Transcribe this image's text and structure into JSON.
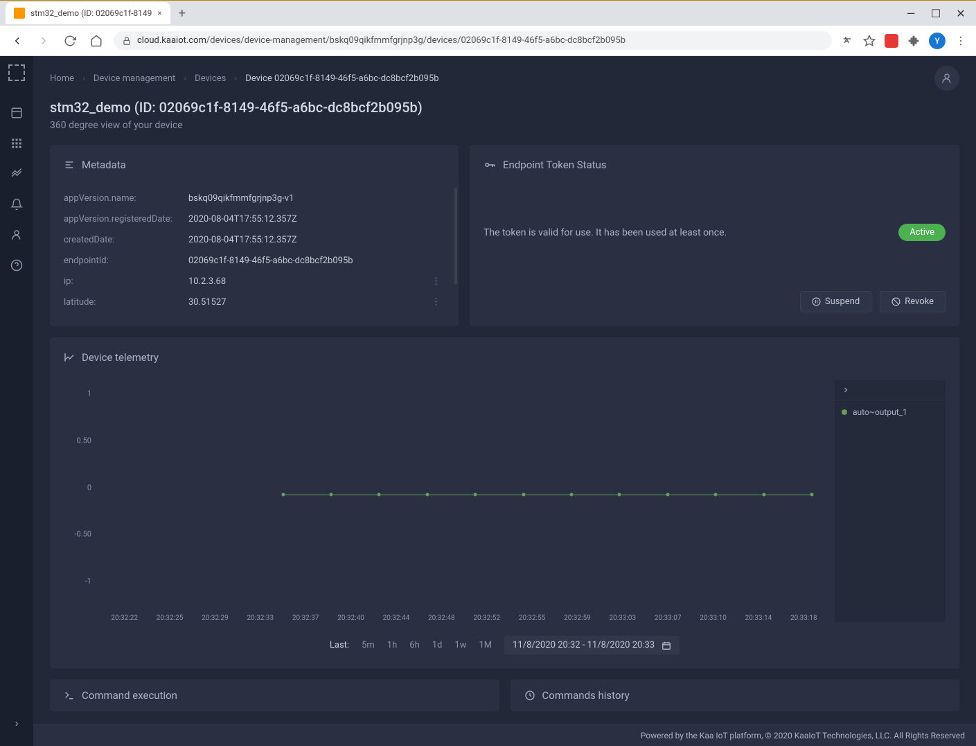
{
  "browser": {
    "tab_title": "stm32_demo (ID: 02069c1f-8149",
    "url_host": "cloud.kaaiot.com",
    "url_path": "/devices/device-management/bskq09qikfmmfgrjnp3g/devices/02069c1f-8149-46f5-a6bc-dc8bcf2b095b",
    "avatar_letter": "Y"
  },
  "breadcrumbs": {
    "items": [
      "Home",
      "Device management",
      "Devices"
    ],
    "current": "Device 02069c1f-8149-46f5-a6bc-dc8bcf2b095b"
  },
  "header": {
    "title": "stm32_demo (ID: 02069c1f-8149-46f5-a6bc-dc8bcf2b095b)",
    "subtitle": "360 degree view of your device"
  },
  "metadata": {
    "title": "Metadata",
    "rows": [
      {
        "key": "appVersion.name:",
        "val": "bskq09qikfmmfgrjnp3g-v1",
        "more": false
      },
      {
        "key": "appVersion.registeredDate:",
        "val": "2020-08-04T17:55:12.357Z",
        "more": false
      },
      {
        "key": "createdDate:",
        "val": "2020-08-04T17:55:12.357Z",
        "more": false
      },
      {
        "key": "endpointId:",
        "val": "02069c1f-8149-46f5-a6bc-dc8bcf2b095b",
        "more": false
      },
      {
        "key": "ip:",
        "val": "10.2.3.68",
        "more": true
      },
      {
        "key": "latitude:",
        "val": "30.51527",
        "more": true
      }
    ]
  },
  "token": {
    "title": "Endpoint Token Status",
    "message": "The token is valid for use. It has been used at least once.",
    "badge": "Active",
    "suspend": "Suspend",
    "revoke": "Revoke"
  },
  "telemetry": {
    "title": "Device telemetry",
    "legend": "auto~output_1",
    "time_label": "Last:",
    "ranges": [
      "5m",
      "1h",
      "6h",
      "1d",
      "1w",
      "1M"
    ],
    "time_range": "11/8/2020 20:32 - 11/8/2020 20:33"
  },
  "chart_data": {
    "type": "line",
    "title": "Device telemetry",
    "xlabel": "",
    "ylabel": "",
    "ylim": [
      -1,
      1
    ],
    "y_ticks": [
      "1",
      "0.50",
      "0",
      "-0.50",
      "-1"
    ],
    "x_ticks": [
      "20:32:22",
      "20:32:25",
      "20:32:29",
      "20:32:33",
      "20:32:37",
      "20:32:40",
      "20:32:44",
      "20:32:48",
      "20:32:52",
      "20:32:55",
      "20:32:59",
      "20:33:03",
      "20:33:07",
      "20:33:10",
      "20:33:14",
      "20:33:18"
    ],
    "series": [
      {
        "name": "auto~output_1",
        "color": "#6b9b5e",
        "x": [
          "20:32:37",
          "20:32:40",
          "20:32:44",
          "20:32:48",
          "20:32:52",
          "20:32:55",
          "20:32:59",
          "20:33:03",
          "20:33:07",
          "20:33:10",
          "20:33:14",
          "20:33:18"
        ],
        "values": [
          0,
          0,
          0,
          0,
          0,
          0,
          0,
          0,
          0,
          0,
          0,
          0
        ]
      }
    ]
  },
  "bottom": {
    "cmd_exec": "Command execution",
    "cmd_hist": "Commands history"
  },
  "footer": "Powered by the Kaa IoT platform, © 2020 KaaIoT Technologies, LLC. All Rights Reserved"
}
